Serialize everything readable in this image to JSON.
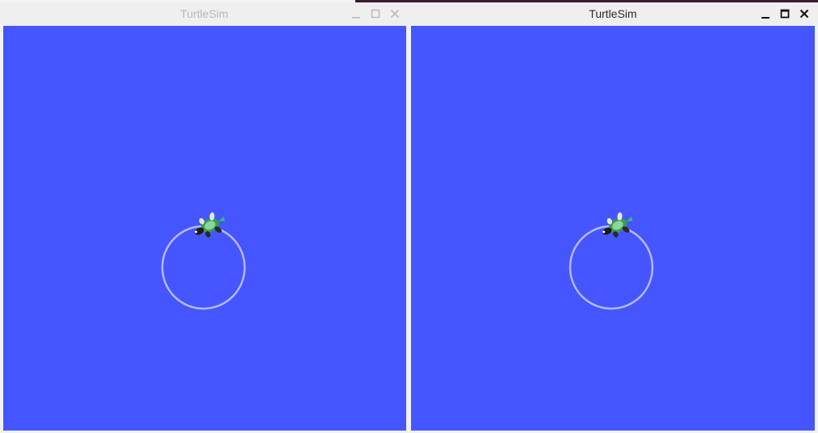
{
  "windows": [
    {
      "id": "left",
      "title": "TurtleSim",
      "focused": false,
      "canvas_color": "#4556ff",
      "trail_color": "#b3b8ff",
      "controls": [
        "minimize-icon",
        "maximize-icon",
        "close-icon"
      ]
    },
    {
      "id": "right",
      "title": "TurtleSim",
      "focused": true,
      "canvas_color": "#4556ff",
      "trail_color": "#b3b8ff",
      "controls": [
        "minimize-icon",
        "maximize-icon",
        "close-icon"
      ]
    }
  ]
}
